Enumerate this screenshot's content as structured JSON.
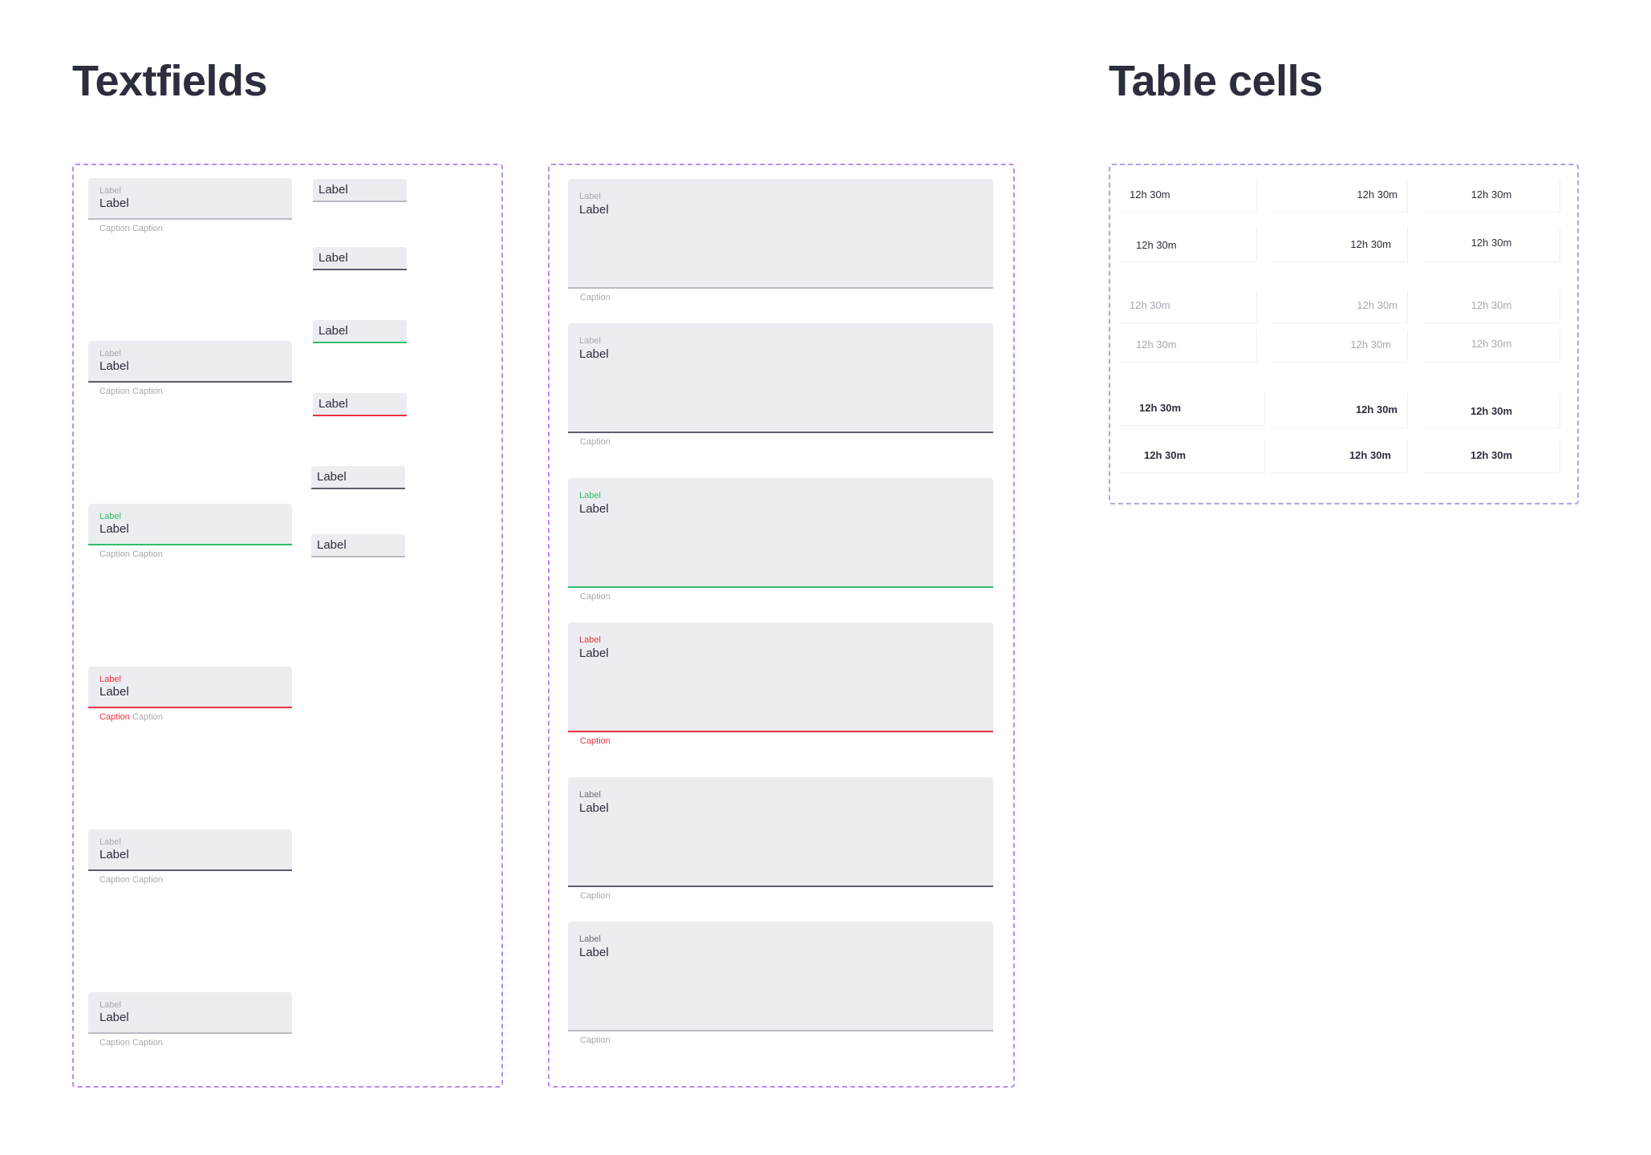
{
  "textfields_section": {
    "title": "Textfields"
  },
  "table_section": {
    "title": "Table cells"
  },
  "small_fields": [
    {
      "label": "Label",
      "value": "Label",
      "caption_a": "",
      "caption_b": "Caption Caption",
      "state": "default"
    },
    {
      "label": "Label",
      "value": "Label",
      "caption_a": "",
      "caption_b": "Caption Caption",
      "state": "hover"
    },
    {
      "label": "Label",
      "value": "Label",
      "caption_a": "",
      "caption_b": "Caption Caption",
      "state": "focus"
    },
    {
      "label": "Label",
      "value": "Label",
      "caption_a": "Caption",
      "caption_b": " Caption",
      "state": "error"
    },
    {
      "label": "Label",
      "value": "Label",
      "caption_a": "",
      "caption_b": "Caption Caption",
      "state": "filled"
    },
    {
      "label": "Label",
      "value": "Label",
      "caption_a": "",
      "caption_b": "Caption Caption",
      "state": "default"
    }
  ],
  "compact_fields": [
    {
      "value": "Label",
      "state": "default"
    },
    {
      "value": "Label",
      "state": "hover"
    },
    {
      "value": "Label",
      "state": "focus"
    },
    {
      "value": "Label",
      "state": "error"
    },
    {
      "value": "Label",
      "state": "filled"
    },
    {
      "value": "Label",
      "state": "default"
    }
  ],
  "textareas": [
    {
      "label": "Label",
      "value": "Label",
      "caption": "Caption",
      "state": "default"
    },
    {
      "label": "Label",
      "value": "Label",
      "caption": "Caption",
      "state": "hover"
    },
    {
      "label": "Label",
      "value": "Label",
      "caption": "Caption",
      "state": "focus"
    },
    {
      "label": "Label",
      "value": "Label",
      "caption": "Caption",
      "state": "error"
    },
    {
      "label": "Label",
      "value": "Label",
      "caption": "Caption",
      "state": "filled"
    },
    {
      "label": "Label",
      "value": "Label",
      "caption": "Caption",
      "state": "default2"
    }
  ],
  "table_cells": {
    "rows": [
      {
        "style": "normal",
        "cells": [
          "12h 30m",
          "12h 30m",
          "12h 30m"
        ]
      },
      {
        "style": "normal",
        "cells": [
          "12h 30m",
          "12h 30m",
          "12h 30m"
        ]
      },
      {
        "style": "dim",
        "cells": [
          "12h 30m",
          "12h 30m",
          "12h 30m"
        ]
      },
      {
        "style": "dim",
        "cells": [
          "12h 30m",
          "12h 30m",
          "12h 30m"
        ]
      },
      {
        "style": "bold",
        "cells": [
          "12h 30m",
          "12h 30m",
          "12h 30m"
        ]
      },
      {
        "style": "bold",
        "cells": [
          "12h 30m",
          "12h 30m",
          "12h 30m"
        ]
      }
    ]
  },
  "colors": {
    "frame_border": "#c08af0",
    "field_bg": "#ecedf0",
    "focus": "#2fbf6a",
    "error": "#ea3342",
    "text": "#2b2e3d",
    "muted": "#a7a9b0"
  }
}
